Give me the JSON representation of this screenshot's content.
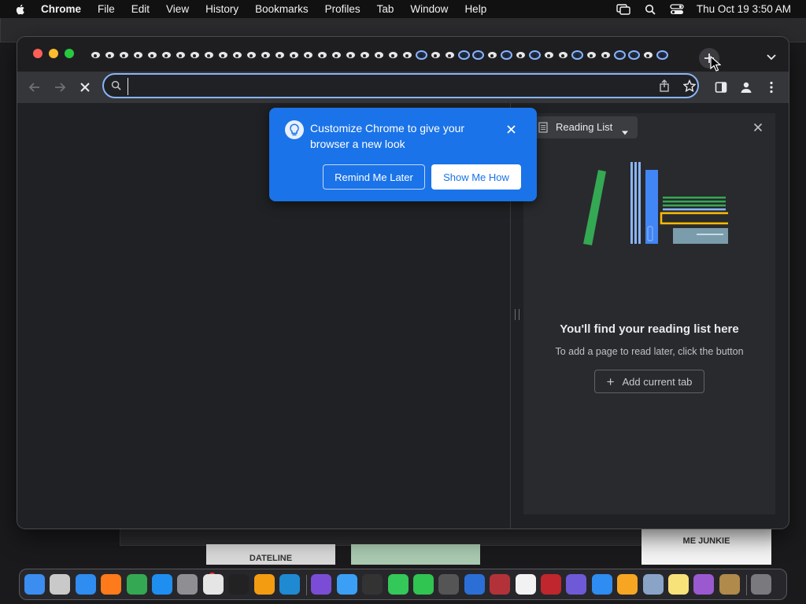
{
  "menubar": {
    "apple_icon": "apple-logo-icon",
    "app_name": "Chrome",
    "items": [
      "File",
      "Edit",
      "View",
      "History",
      "Bookmarks",
      "Profiles",
      "Tab",
      "Window",
      "Help"
    ],
    "status_icons": [
      "screen-mirroring-icon",
      "spotlight-search-icon",
      "control-center-icon"
    ],
    "clock": "Thu Oct 19  3:50 AM"
  },
  "bubble": {
    "text": "Customize Chrome to give your browser a new look",
    "remind_label": "Remind Me Later",
    "show_label": "Show Me How"
  },
  "reading_list": {
    "dropdown_label": "Reading List",
    "title": "You'll find your reading list here",
    "subtitle": "To add a page to read later, click the button",
    "add_label": "Add current tab"
  },
  "background": {
    "thumb_left_label": "DATELINE",
    "thumb_right_label": "ME JUNKIE"
  },
  "colors": {
    "accent_blue": "#1a73e8",
    "focus_ring": "#8ab4f8",
    "toolbar": "#35363a",
    "panel": "#292a2d"
  }
}
